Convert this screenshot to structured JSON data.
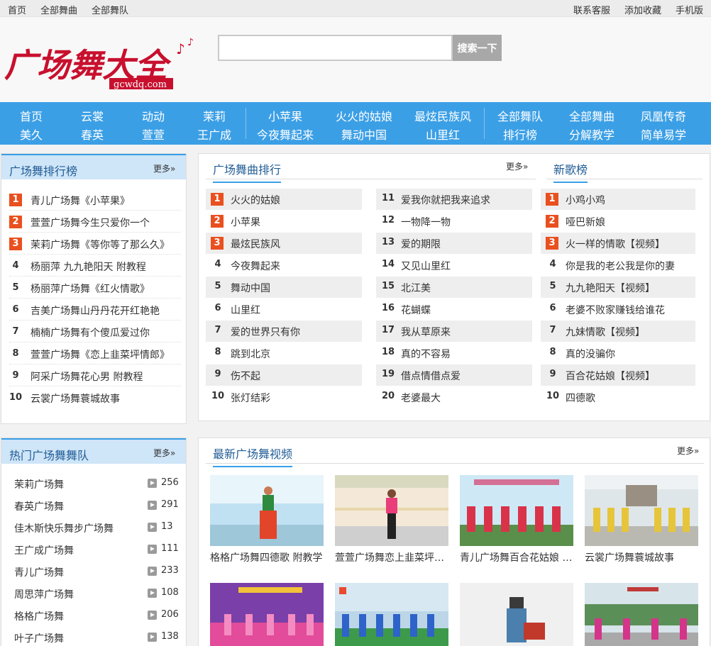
{
  "topbar": {
    "left": [
      "首页",
      "全部舞曲",
      "全部舞队"
    ],
    "right": [
      "联系客服",
      "添加收藏",
      "手机版"
    ]
  },
  "logo": {
    "text": "广场舞大全",
    "domain": "gcwdq.com"
  },
  "search": {
    "placeholder": "",
    "button": "搜索一下"
  },
  "nav": {
    "group1_row1": [
      "首页",
      "云裳",
      "动动",
      "茉莉"
    ],
    "group1_row2": [
      "美久",
      "春英",
      "萱萱",
      "王广成"
    ],
    "group2_row1": [
      "小苹果",
      "火火的姑娘",
      "最炫民族风"
    ],
    "group2_row2": [
      "今夜舞起来",
      "舞动中国",
      "山里红"
    ],
    "group3_row1": [
      "全部舞队",
      "全部舞曲",
      "凤凰传奇"
    ],
    "group3_row2": [
      "排行榜",
      "分解教学",
      "简单易学"
    ]
  },
  "more_label": "更多",
  "rank_panel": {
    "title": "广场舞排行榜",
    "items": [
      {
        "num": "1",
        "text": "青儿广场舞《小苹果》"
      },
      {
        "num": "2",
        "text": "萱萱广场舞今生只爱你一个"
      },
      {
        "num": "3",
        "text": "茉莉广场舞《等你等了那么久》"
      },
      {
        "num": "4",
        "text": "杨丽萍 九九艳阳天 附教程"
      },
      {
        "num": "5",
        "text": "杨丽萍广场舞《红火情歌》"
      },
      {
        "num": "6",
        "text": "吉美广场舞山丹丹花开红艳艳"
      },
      {
        "num": "7",
        "text": "楠楠广场舞有个傻瓜爱过你"
      },
      {
        "num": "8",
        "text": "萱萱广场舞《恋上韭菜坪情郎》"
      },
      {
        "num": "9",
        "text": "阿采广场舞花心男 附教程"
      },
      {
        "num": "10",
        "text": "云裳广场舞蓑城故事"
      }
    ]
  },
  "song_panel": {
    "title": "广场舞曲排行",
    "col1": [
      {
        "num": "1",
        "text": "火火的姑娘"
      },
      {
        "num": "2",
        "text": "小苹果"
      },
      {
        "num": "3",
        "text": "最炫民族风"
      },
      {
        "num": "4",
        "text": "今夜舞起来"
      },
      {
        "num": "5",
        "text": "舞动中国"
      },
      {
        "num": "6",
        "text": "山里红"
      },
      {
        "num": "7",
        "text": "爱的世界只有你"
      },
      {
        "num": "8",
        "text": "跳到北京"
      },
      {
        "num": "9",
        "text": "伤不起"
      },
      {
        "num": "10",
        "text": "张灯结彩"
      }
    ],
    "col2": [
      {
        "num": "11",
        "text": "爱我你就把我来追求"
      },
      {
        "num": "12",
        "text": "一物降一物"
      },
      {
        "num": "13",
        "text": "爱的期限"
      },
      {
        "num": "14",
        "text": "又见山里红"
      },
      {
        "num": "15",
        "text": "北江美"
      },
      {
        "num": "16",
        "text": "花蝴蝶"
      },
      {
        "num": "17",
        "text": "我从草原来"
      },
      {
        "num": "18",
        "text": "真的不容易"
      },
      {
        "num": "19",
        "text": "借点情借点爱"
      },
      {
        "num": "20",
        "text": "老婆最大"
      }
    ]
  },
  "new_panel": {
    "title": "新歌榜",
    "items": [
      {
        "num": "1",
        "text": "小鸡小鸡"
      },
      {
        "num": "2",
        "text": "哑巴新娘"
      },
      {
        "num": "3",
        "text": "火一样的情歌【视频】"
      },
      {
        "num": "4",
        "text": "你是我的老公我是你的妻"
      },
      {
        "num": "5",
        "text": "九九艳阳天【视频】"
      },
      {
        "num": "6",
        "text": "老婆不败家赚钱给谁花"
      },
      {
        "num": "7",
        "text": "九妹情歌【视频】"
      },
      {
        "num": "8",
        "text": "真的没骗你"
      },
      {
        "num": "9",
        "text": "百合花姑娘【视频】"
      },
      {
        "num": "10",
        "text": "四德歌"
      }
    ]
  },
  "team_panel": {
    "title": "热门广场舞舞队",
    "items": [
      {
        "name": "茉莉广场舞",
        "count": "256"
      },
      {
        "name": "春英广场舞",
        "count": "291"
      },
      {
        "name": "佳木斯快乐舞步广场舞",
        "count": "13"
      },
      {
        "name": "王广成广场舞",
        "count": "111"
      },
      {
        "name": "青儿广场舞",
        "count": "233"
      },
      {
        "name": "周思萍广场舞",
        "count": "108"
      },
      {
        "name": "格格广场舞",
        "count": "206"
      },
      {
        "name": "叶子广场舞",
        "count": "138"
      }
    ]
  },
  "video_panel": {
    "title": "最新广场舞视频",
    "videos": [
      {
        "title": "格格广场舞四德歌 附教学"
      },
      {
        "title": "萱萱广场舞恋上韭菜坪情郎"
      },
      {
        "title": "青儿广场舞百合花姑娘 附教程"
      },
      {
        "title": "云裳广场舞蓑城故事"
      }
    ]
  },
  "colors": {
    "nav_bg": "#3b9fe6",
    "rank_badge": "#e9501f",
    "panel_title": "#215d96",
    "panel_head_bg": "#cfe5f8"
  }
}
